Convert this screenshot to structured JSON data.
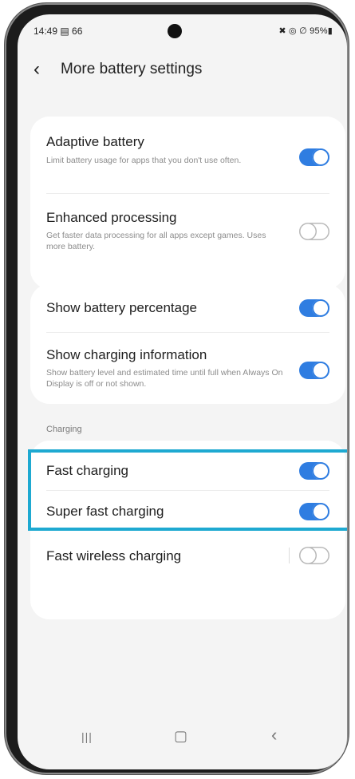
{
  "status_bar": {
    "time": "14:49 ▤ 66",
    "right_icons": "✖ ◎ ∅ 95%▮"
  },
  "header": {
    "back_glyph": "‹",
    "title": "More battery settings"
  },
  "settings": {
    "adaptive_battery": {
      "label": "Adaptive battery",
      "description": "Limit battery usage for apps that you don't use often.",
      "enabled": true
    },
    "enhanced_processing": {
      "label": "Enhanced processing",
      "description": "Get faster data processing for all apps except games. Uses more battery.",
      "enabled": false
    },
    "show_battery_percentage": {
      "label": "Show battery percentage",
      "enabled": true
    },
    "show_charging_information": {
      "label": "Show charging information",
      "description": "Show battery level and estimated time until full when Always On Display is off or not shown.",
      "enabled": true
    }
  },
  "charging": {
    "section_label": "Charging",
    "fast_charging": {
      "label": "Fast charging",
      "enabled": true
    },
    "super_fast_charging": {
      "label": "Super fast charging",
      "enabled": true
    },
    "fast_wireless_charging": {
      "label": "Fast wireless charging",
      "enabled": false
    }
  },
  "nav_bar": {
    "recents_glyph": "|||",
    "home_glyph": "▢",
    "back_glyph": "‹"
  },
  "colors": {
    "toggle_on": "#2f7de1",
    "highlight": "#1ea9d1",
    "background": "#f4f4f4"
  }
}
